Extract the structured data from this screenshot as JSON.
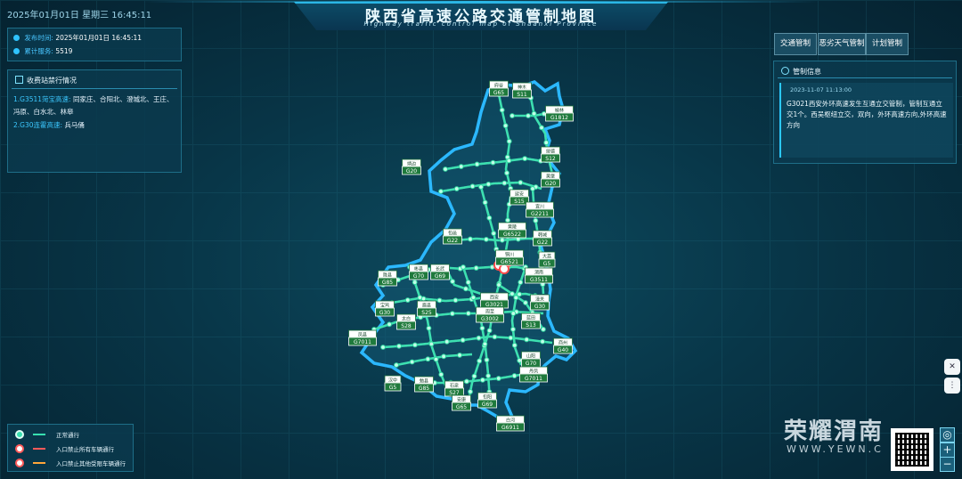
{
  "header": {
    "datetime": "2025年01月01日  星期三  16:45:11",
    "title": "陕西省高速公路交通管制地图",
    "subtitle": "Highway traffic control map of Shaanxi Province"
  },
  "stats": {
    "release_time_label": "发布时间:",
    "release_time_value": "2025年01月01日 16:45:11",
    "access_count_label": "累计服务:",
    "access_count_value": "5519"
  },
  "toll_panel": {
    "title": "收费站禁行情况",
    "items": [
      {
        "road": "1.G3511菏宝高速:",
        "stations": "同家庄、合阳北、澄城北、王庄、冯原、白水北、林皋"
      },
      {
        "road": "2.G30连霍高速:",
        "stations": "兵马俑"
      }
    ]
  },
  "buttons": {
    "traffic": "交通管制",
    "weather": "恶劣天气管制",
    "plan": "计划管制"
  },
  "info_panel": {
    "title": "管制信息",
    "date": "2023-11-07 11:13:00",
    "text": "G3021西安外环高速发生互通立交管制，管制互通立交1个。西吴枢纽立交，双向，外环高速方向,外环高速方向"
  },
  "legend": {
    "items": [
      {
        "label": "正常通行",
        "color": "#38e0b0"
      },
      {
        "label": "入口禁止所有车辆通行",
        "color": "#ff5a5a"
      },
      {
        "label": "入口禁止其他受限车辆通行",
        "color": "#ffa63a"
      }
    ]
  },
  "watermark": {
    "text": "荣耀渭南",
    "url": "WWW.YEWN.C"
  },
  "map_labels": [
    {
      "name": "府谷",
      "code": "G65"
    },
    {
      "name": "神木",
      "code": "S11"
    },
    {
      "name": "榆林",
      "code": "G1812"
    },
    {
      "name": "绥德",
      "code": "S12"
    },
    {
      "name": "吴堡",
      "code": "G20"
    },
    {
      "name": "靖边",
      "code": "G20"
    },
    {
      "name": "延安",
      "code": "S15"
    },
    {
      "name": "宜川",
      "code": "G2211"
    },
    {
      "name": "黄陵",
      "code": "G6522"
    },
    {
      "name": "旬邑",
      "code": "G22"
    },
    {
      "name": "韩城",
      "code": "G22"
    },
    {
      "name": "铜川",
      "code": "G6521"
    },
    {
      "name": "大荔",
      "code": "G5"
    },
    {
      "name": "渭南",
      "code": "G3511"
    },
    {
      "name": "陇县",
      "code": "G85"
    },
    {
      "name": "彬县",
      "code": "G70"
    },
    {
      "name": "长武",
      "code": "G69"
    },
    {
      "name": "西安",
      "code": "G3021"
    },
    {
      "name": "潼关",
      "code": "G30"
    },
    {
      "name": "宝鸡",
      "code": "G30"
    },
    {
      "name": "眉县",
      "code": "S25"
    },
    {
      "name": "周至",
      "code": "G3002"
    },
    {
      "name": "蓝田",
      "code": "S13"
    },
    {
      "name": "太白",
      "code": "S28"
    },
    {
      "name": "凤县",
      "code": "G7011"
    },
    {
      "name": "商州",
      "code": "G40"
    },
    {
      "name": "山阳",
      "code": "G70"
    },
    {
      "name": "丹凤",
      "code": "G7011"
    },
    {
      "name": "汉中",
      "code": "G5"
    },
    {
      "name": "勉县",
      "code": "G85"
    },
    {
      "name": "石泉",
      "code": "S27"
    },
    {
      "name": "安康",
      "code": "G65"
    },
    {
      "name": "旬阳",
      "code": "G69"
    },
    {
      "name": "白河",
      "code": "G6911"
    }
  ]
}
